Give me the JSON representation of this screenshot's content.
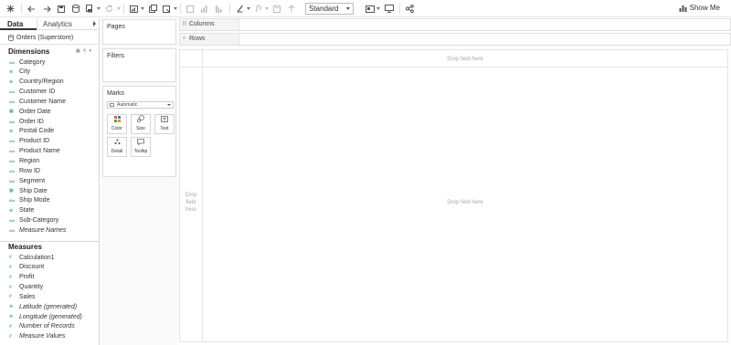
{
  "toolbar": {
    "view_mode": "Standard",
    "show_me": "Show Me",
    "icons": [
      "tableau-logo-icon",
      "undo-icon",
      "redo-icon",
      "save-icon",
      "new-datasource-icon",
      "pause-icon",
      "refresh-icon",
      "new-worksheet-icon",
      "duplicate-icon",
      "clear-icon",
      "swap-icon",
      "sort-asc-icon",
      "sort-desc-icon",
      "highlight-icon",
      "group-icon",
      "label-icon",
      "fix-axes-icon",
      "card-icon",
      "presentation-icon",
      "share-icon"
    ]
  },
  "data_pane": {
    "tabs": [
      "Data",
      "Analytics"
    ],
    "source": "Orders (Superstore)",
    "dimensions_title": "Dimensions",
    "dimensions": [
      {
        "label": "Category",
        "type": "abc"
      },
      {
        "label": "City",
        "type": "geo"
      },
      {
        "label": "Country/Region",
        "type": "geo"
      },
      {
        "label": "Customer ID",
        "type": "abc"
      },
      {
        "label": "Customer Name",
        "type": "abc"
      },
      {
        "label": "Order Date",
        "type": "date"
      },
      {
        "label": "Order ID",
        "type": "abc"
      },
      {
        "label": "Postal Code",
        "type": "geo"
      },
      {
        "label": "Product ID",
        "type": "abc"
      },
      {
        "label": "Product Name",
        "type": "abc"
      },
      {
        "label": "Region",
        "type": "abc"
      },
      {
        "label": "Row ID",
        "type": "abc"
      },
      {
        "label": "Segment",
        "type": "abc"
      },
      {
        "label": "Ship Date",
        "type": "date"
      },
      {
        "label": "Ship Mode",
        "type": "abc"
      },
      {
        "label": "State",
        "type": "geo"
      },
      {
        "label": "Sub-Category",
        "type": "abc"
      },
      {
        "label": "Measure Names",
        "type": "abc",
        "italic": true
      }
    ],
    "measures_title": "Measures",
    "measures": [
      {
        "label": "Calculation1",
        "type": "num"
      },
      {
        "label": "Discount",
        "type": "num"
      },
      {
        "label": "Profit",
        "type": "num"
      },
      {
        "label": "Quantity",
        "type": "num"
      },
      {
        "label": "Sales",
        "type": "num"
      },
      {
        "label": "Latitude (generated)",
        "type": "geo",
        "italic": true
      },
      {
        "label": "Longitude (generated)",
        "type": "geo",
        "italic": true
      },
      {
        "label": "Number of Records",
        "type": "num",
        "italic": true
      },
      {
        "label": "Measure Values",
        "type": "num",
        "italic": true
      }
    ]
  },
  "cards": {
    "pages": "Pages",
    "filters": "Filters",
    "marks": "Marks",
    "mark_type": "Automatic",
    "mark_buttons": [
      {
        "label": "Color",
        "icon": "color-icon"
      },
      {
        "label": "Size",
        "icon": "size-icon"
      },
      {
        "label": "Text",
        "icon": "text-icon"
      },
      {
        "label": "Detail",
        "icon": "detail-icon"
      },
      {
        "label": "Tooltip",
        "icon": "tooltip-icon"
      }
    ]
  },
  "shelves": {
    "columns": "Columns",
    "rows": "Rows"
  },
  "canvas": {
    "drop_top": "Drop field here",
    "drop_center": "Drop field here",
    "drop_left": [
      "Drop",
      "field",
      "here"
    ]
  }
}
